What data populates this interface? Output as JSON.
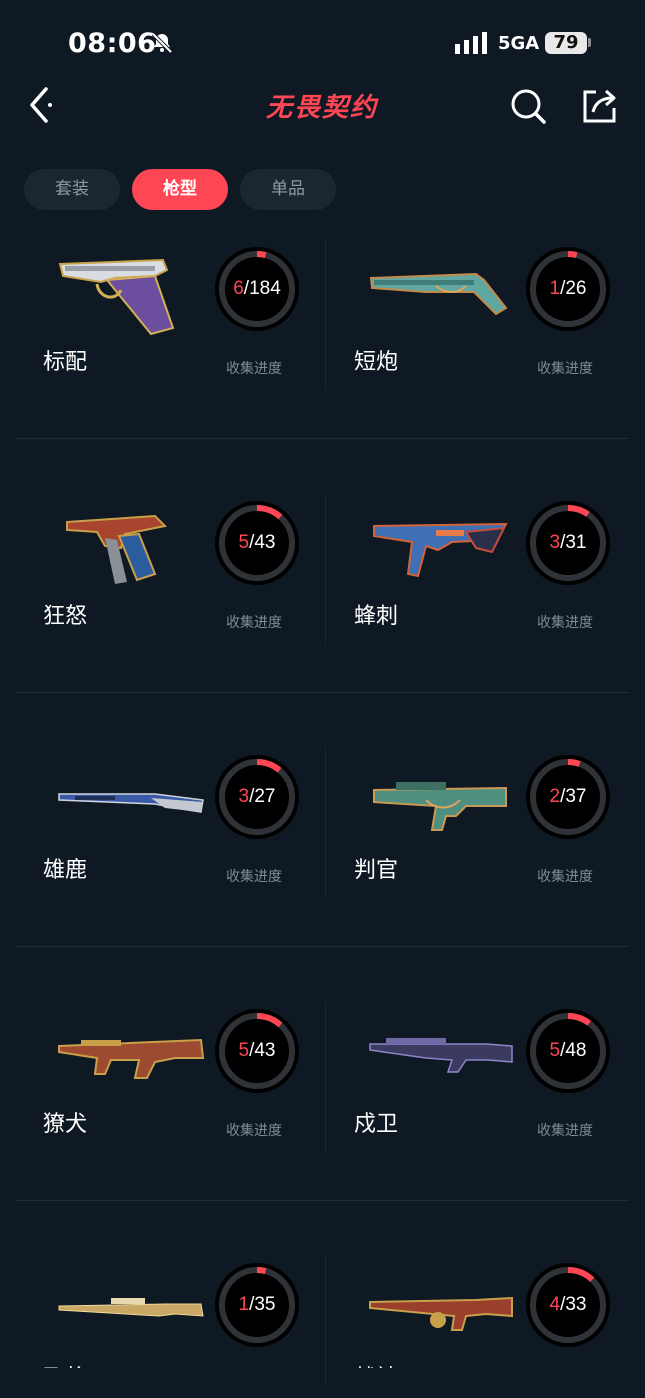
{
  "status": {
    "time": "08:06",
    "network": "5GA",
    "battery": "79"
  },
  "header": {
    "title": "无畏契约"
  },
  "tabs": [
    {
      "label": "套装",
      "active": false
    },
    {
      "label": "枪型",
      "active": true
    },
    {
      "label": "单品",
      "active": false
    }
  ],
  "progress_label": "收集进度",
  "colors": {
    "accent": "#ff4655",
    "background": "#0f1923"
  },
  "weapons": [
    {
      "name": "标配",
      "collected": "6",
      "total": "184"
    },
    {
      "name": "短炮",
      "collected": "1",
      "total": "26"
    },
    {
      "name": "狂怒",
      "collected": "5",
      "total": "43"
    },
    {
      "name": "蜂刺",
      "collected": "3",
      "total": "31"
    },
    {
      "name": "雄鹿",
      "collected": "3",
      "total": "27"
    },
    {
      "name": "判官",
      "collected": "2",
      "total": "37"
    },
    {
      "name": "獠犬",
      "collected": "5",
      "total": "43"
    },
    {
      "name": "戍卫",
      "collected": "5",
      "total": "48"
    },
    {
      "name": "飞将",
      "collected": "1",
      "total": "35"
    },
    {
      "name": "战神",
      "collected": "4",
      "total": "33"
    }
  ]
}
